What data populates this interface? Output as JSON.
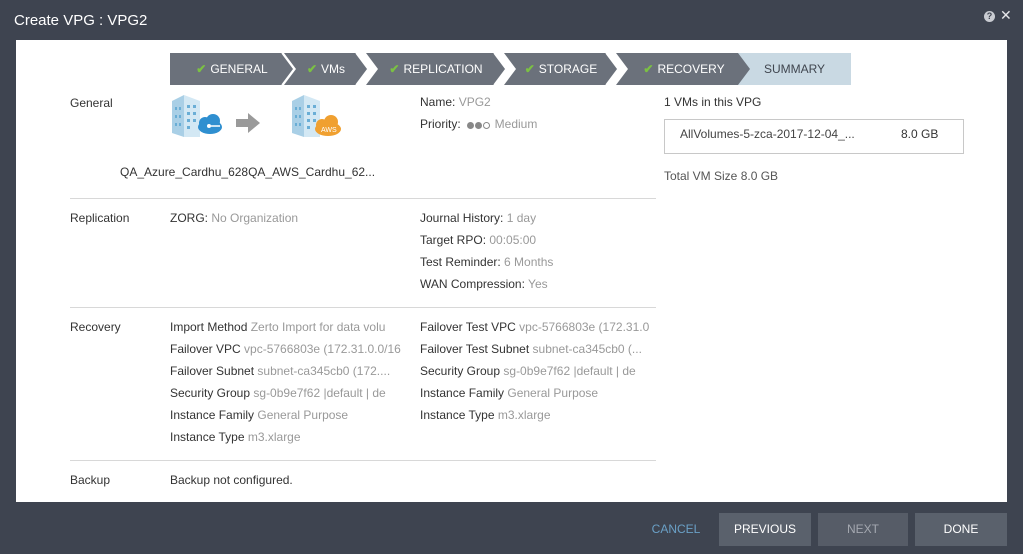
{
  "window": {
    "title": "Create VPG : VPG2",
    "help_glyph": "?",
    "close_glyph": "✕"
  },
  "steps": [
    {
      "label": "GENERAL",
      "done": true
    },
    {
      "label": "VMs",
      "done": true
    },
    {
      "label": "REPLICATION",
      "done": true
    },
    {
      "label": "STORAGE",
      "done": true
    },
    {
      "label": "RECOVERY",
      "done": true
    },
    {
      "label": "SUMMARY",
      "done": false
    }
  ],
  "check_glyph": "✔",
  "general": {
    "section_label": "General",
    "sites_text": "QA_Azure_Cardhu_628QA_AWS_Cardhu_62...",
    "name_label": "Name:",
    "name_value": "VPG2",
    "priority_label": "Priority:",
    "priority_value": "Medium",
    "priority_level": 2,
    "aws_badge": "AWS"
  },
  "vms": {
    "title": "1 VMs in this VPG",
    "items": [
      {
        "name": "AllVolumes-5-zca-2017-12-04_...",
        "size": "8.0 GB"
      }
    ],
    "total": "Total VM Size 8.0 GB"
  },
  "replication": {
    "section_label": "Replication",
    "zorg_label": "ZORG:",
    "zorg_value": "No Organization",
    "journal_label": "Journal History:",
    "journal_value": "1 day",
    "rpo_label": "Target RPO:",
    "rpo_value": "00:05:00",
    "reminder_label": "Test Reminder:",
    "reminder_value": "6 Months",
    "wan_label": "WAN Compression:",
    "wan_value": "Yes"
  },
  "recovery": {
    "section_label": "Recovery",
    "left": [
      {
        "label": "Import Method",
        "value": "Zerto Import for data volu"
      },
      {
        "label": "Failover VPC",
        "value": "vpc-5766803e (172.31.0.0/16"
      },
      {
        "label": "Failover Subnet",
        "value": "subnet-ca345cb0 (172...."
      },
      {
        "label": "Security Group",
        "value": "sg-0b9e7f62 |default | de"
      },
      {
        "label": "Instance Family",
        "value": "General Purpose"
      },
      {
        "label": "Instance Type",
        "value": "m3.xlarge"
      }
    ],
    "right": [
      {
        "label": "Failover Test VPC",
        "value": "vpc-5766803e (172.31.0"
      },
      {
        "label": "Failover Test Subnet",
        "value": "subnet-ca345cb0 (..."
      },
      {
        "label": "Security Group",
        "value": "sg-0b9e7f62 |default | de"
      },
      {
        "label": "Instance Family",
        "value": "General Purpose"
      },
      {
        "label": "Instance Type",
        "value": "m3.xlarge"
      }
    ]
  },
  "backup": {
    "section_label": "Backup",
    "value": "Backup not configured."
  },
  "footer": {
    "cancel": "CANCEL",
    "previous": "PREVIOUS",
    "next": "NEXT",
    "done": "DONE"
  }
}
